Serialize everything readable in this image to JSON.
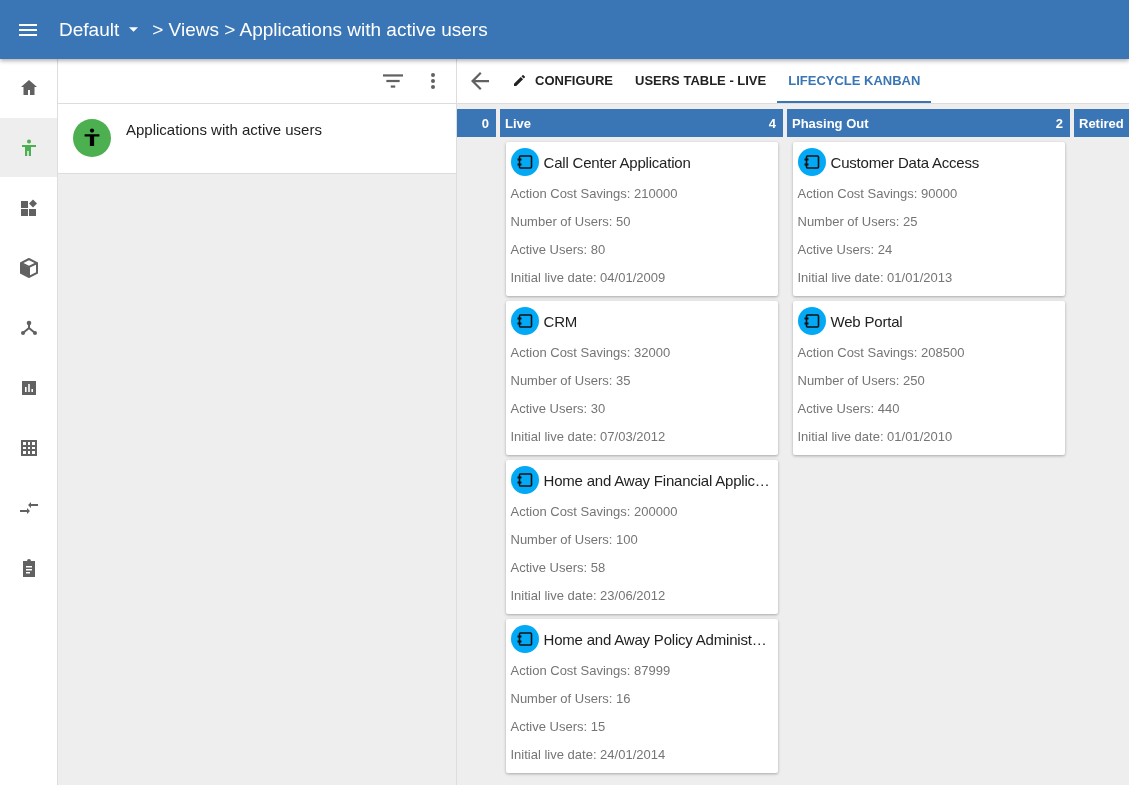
{
  "header": {
    "workspace": "Default",
    "breadcrumb": "> Views > Applications with active users"
  },
  "rail": [
    {
      "kind": "home",
      "selected": false
    },
    {
      "kind": "person",
      "selected": true
    },
    {
      "kind": "widgets",
      "selected": false
    },
    {
      "kind": "cube",
      "selected": false
    },
    {
      "kind": "hub",
      "selected": false
    },
    {
      "kind": "chart",
      "selected": false
    },
    {
      "kind": "grid",
      "selected": false
    },
    {
      "kind": "merge",
      "selected": false
    },
    {
      "kind": "clipboard",
      "selected": false
    }
  ],
  "views": [
    {
      "label": "Applications with active users"
    }
  ],
  "tabs": [
    {
      "label": "CONFIGURE",
      "kind": "edit",
      "selected": false
    },
    {
      "label": "USERS TABLE - LIVE",
      "kind": "plain",
      "selected": false
    },
    {
      "label": "LIFECYCLE KANBAN",
      "kind": "plain",
      "selected": true
    }
  ],
  "columns": [
    {
      "count": "0"
    },
    {
      "title": "Live",
      "count": "4",
      "cards": [
        {
          "title": "Call Center Application",
          "fields": [
            "Action Cost Savings: 210000",
            "Number of Users: 50",
            "Active Users: 80",
            "Initial live date: 04/01/2009"
          ]
        },
        {
          "title": "CRM",
          "fields": [
            "Action Cost Savings: 32000",
            "Number of Users: 35",
            "Active Users: 30",
            "Initial live date: 07/03/2012"
          ]
        },
        {
          "title": "Home and Away Financial Applic…",
          "fields": [
            "Action Cost Savings: 200000",
            "Number of Users: 100",
            "Active Users: 58",
            "Initial live date: 23/06/2012"
          ]
        },
        {
          "title": "Home and Away Policy Administ…",
          "fields": [
            "Action Cost Savings: 87999",
            "Number of Users: 16",
            "Active Users: 15",
            "Initial live date: 24/01/2014"
          ]
        }
      ]
    },
    {
      "title": "Phasing Out",
      "count": "2",
      "cards": [
        {
          "title": "Customer Data Access",
          "fields": [
            "Action Cost Savings: 90000",
            "Number of Users: 25",
            "Active Users: 24",
            "Initial live date: 01/01/2013"
          ]
        },
        {
          "title": "Web Portal",
          "fields": [
            "Action Cost Savings: 208500",
            "Number of Users: 250",
            "Active Users: 440",
            "Initial live date: 01/01/2010"
          ]
        }
      ]
    },
    {
      "title": "Retired"
    }
  ]
}
